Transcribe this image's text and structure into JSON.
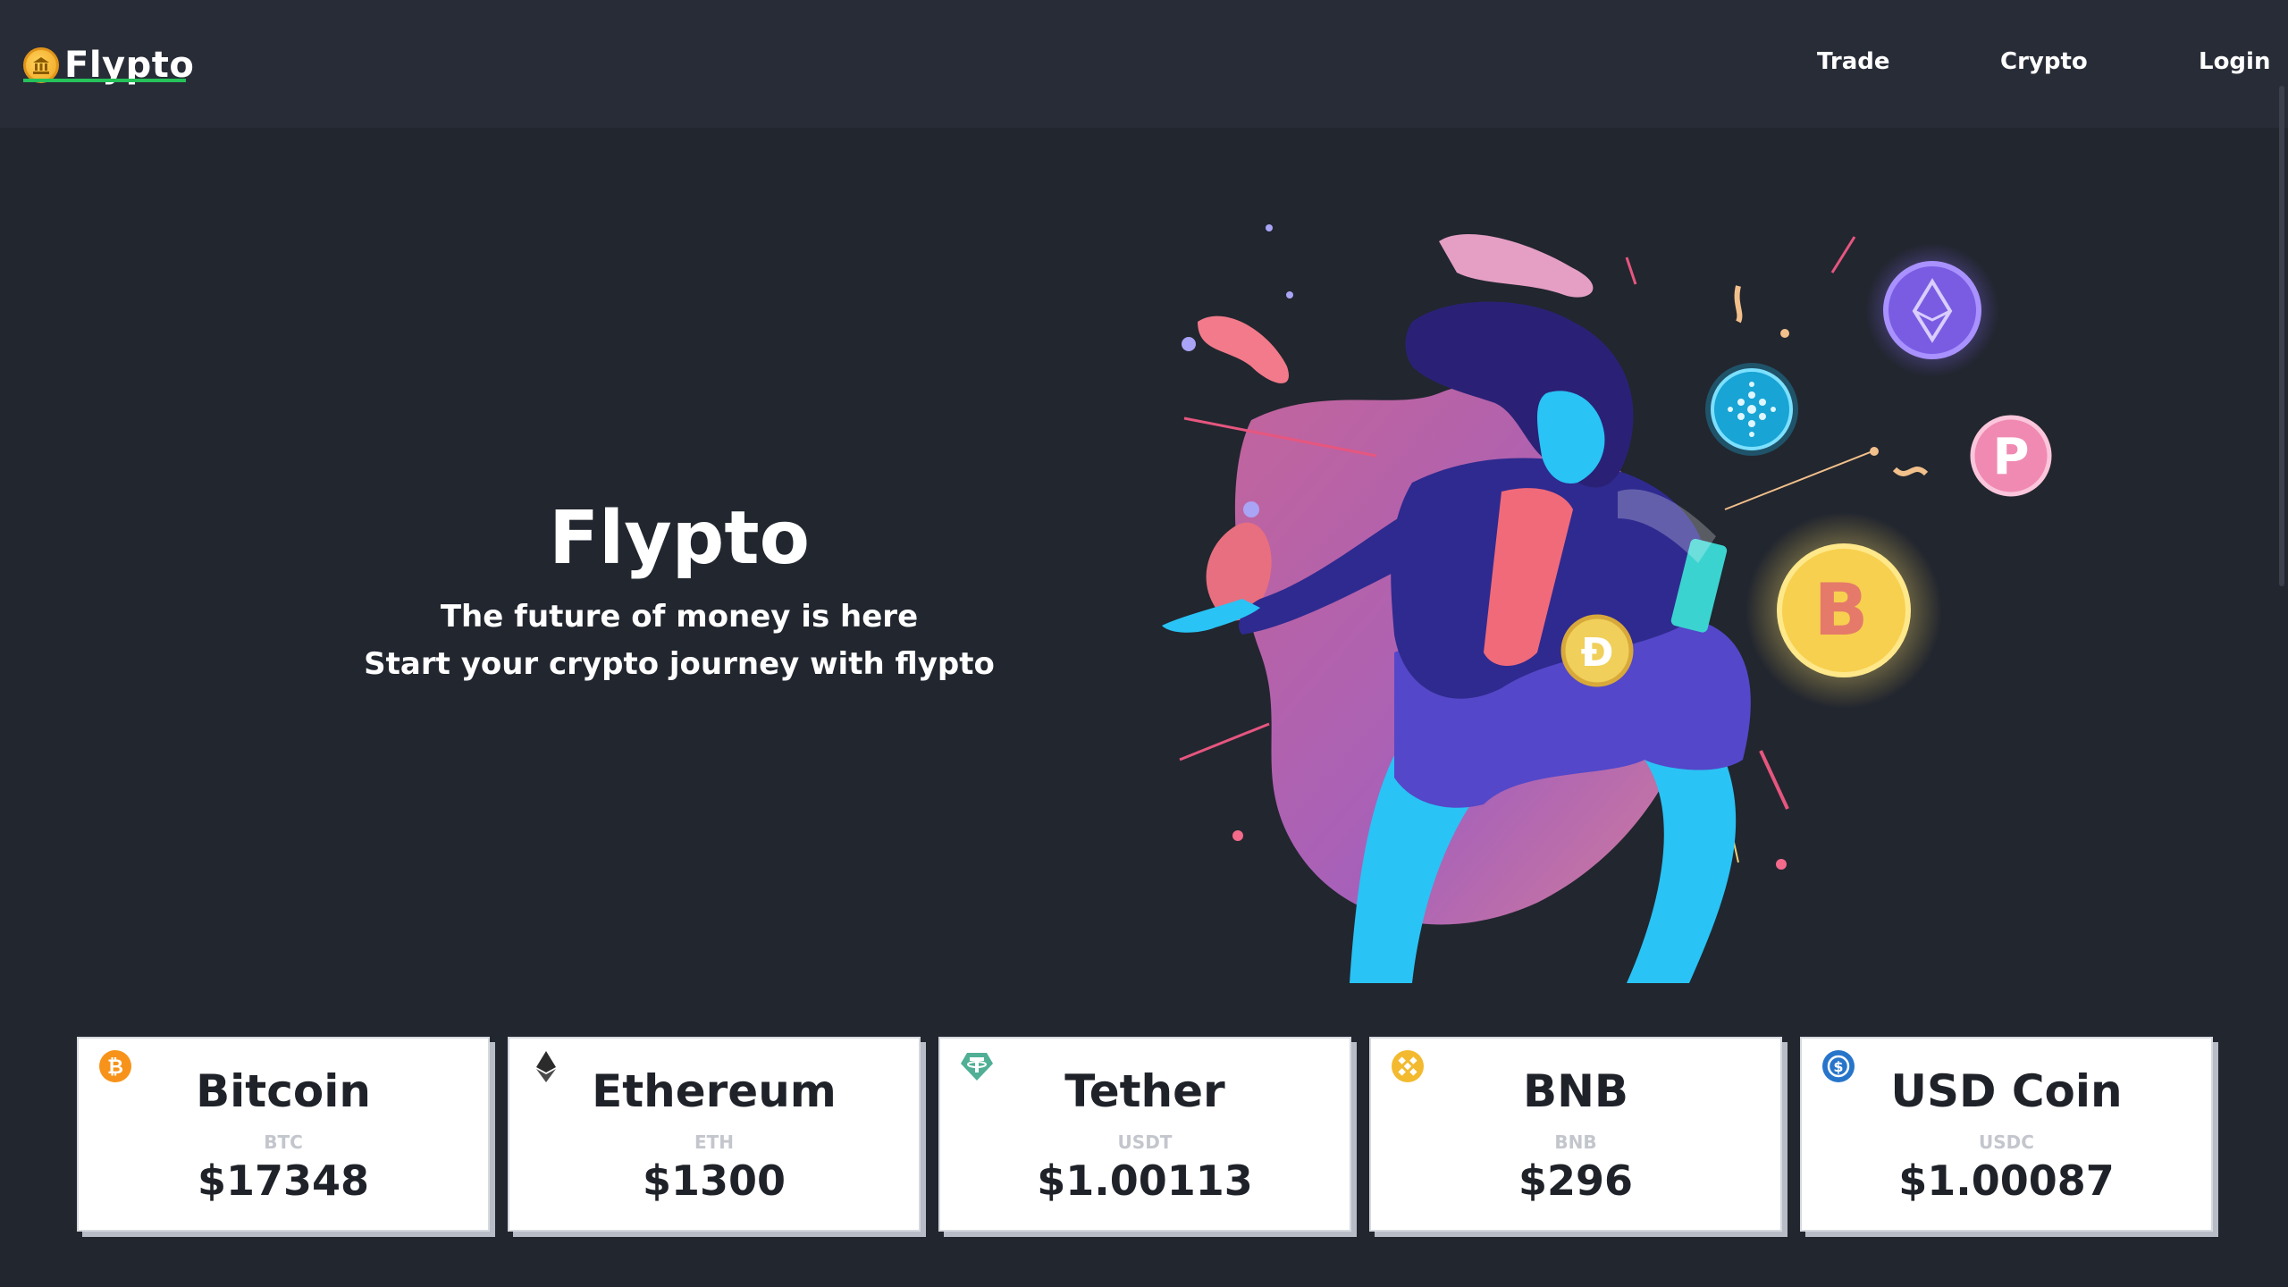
{
  "nav": {
    "brand": "Flypto",
    "links": [
      {
        "label": "Trade"
      },
      {
        "label": "Crypto"
      },
      {
        "label": "Login"
      }
    ]
  },
  "hero": {
    "title": "Flypto",
    "subtitle_line1": "The future of money is here",
    "subtitle_line2": "Start your crypto journey with flypto"
  },
  "coins": [
    {
      "name": "Bitcoin",
      "symbol": "BTC",
      "price": "$17348",
      "icon": "bitcoin-icon",
      "color": "#f7931a"
    },
    {
      "name": "Ethereum",
      "symbol": "ETH",
      "price": "$1300",
      "icon": "ethereum-icon",
      "color": "#2b2b2b"
    },
    {
      "name": "Tether",
      "symbol": "USDT",
      "price": "$1.00113",
      "icon": "tether-icon",
      "color": "#50af95"
    },
    {
      "name": "BNB",
      "symbol": "BNB",
      "price": "$296",
      "icon": "bnb-icon",
      "color": "#f3ba2f"
    },
    {
      "name": "USD Coin",
      "symbol": "USDC",
      "price": "$1.00087",
      "icon": "usdc-icon",
      "color": "#2775ca"
    }
  ],
  "colors": {
    "background": "#22262f",
    "navbar": "#282c37",
    "accent_underline": "#26c25a",
    "card": "#ffffff"
  }
}
